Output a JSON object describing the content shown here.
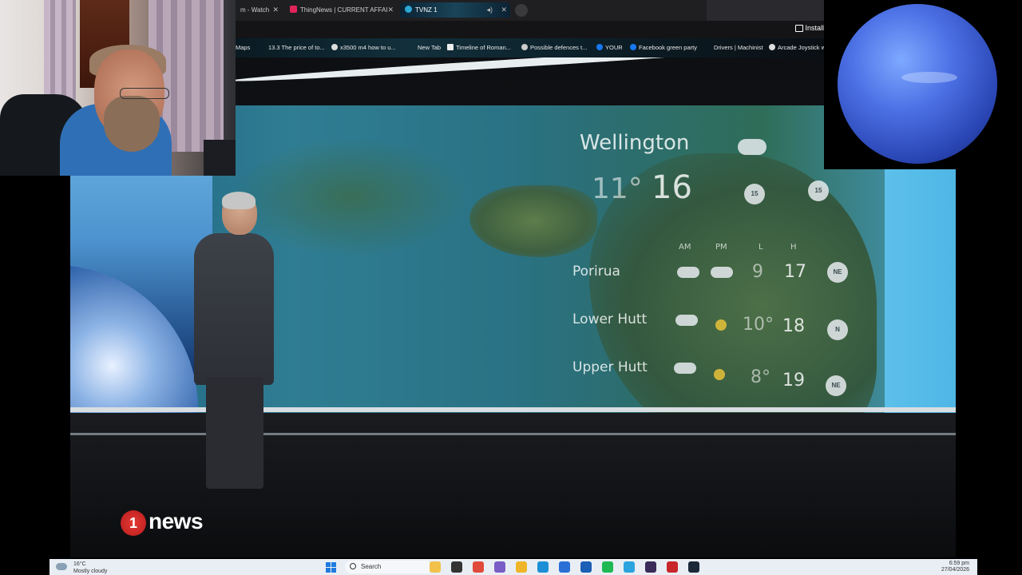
{
  "browser": {
    "tabs": [
      {
        "label": "m - Watch",
        "active": false,
        "icon": "page-icon"
      },
      {
        "label": "ThingNews | CURRENT AFFAI",
        "active": false,
        "icon": "youtube-icon"
      },
      {
        "label": "TVNZ 1",
        "active": true,
        "icon": "tvnz-icon"
      }
    ],
    "install_label": "Install",
    "bookmarks": [
      "Maps",
      "13.3 The price of to...",
      "x3500 m4 how to u...",
      "New Tab",
      "Timeline of Roman...",
      "Possible defences t...",
      "YOUR",
      "Facebook green party",
      "Drivers | Machinist",
      "Arcade Joystick w"
    ]
  },
  "broadcast": {
    "forecast": {
      "city": "Wellington",
      "min": "11°",
      "max": "16",
      "wind_badges": [
        "15",
        "15"
      ],
      "columns": [
        "AM",
        "PM",
        "L",
        "H"
      ],
      "rows": [
        {
          "name": "Porirua",
          "min": "9",
          "max": "17",
          "wind": "NE"
        },
        {
          "name": "Lower Hutt",
          "min": "10°",
          "max": "18",
          "wind": "N"
        },
        {
          "name": "Upper Hutt",
          "min": "8°",
          "max": "19",
          "wind": "NE"
        }
      ]
    },
    "logo_number": "1",
    "logo_word": "news"
  },
  "taskbar": {
    "weather_temp": "16°C",
    "weather_condition": "Mostly cloudy",
    "search_label": "Search",
    "time": "6:59 pm",
    "date": "27/04/2026",
    "apps": [
      {
        "name": "file-explorer-icon",
        "color": "#f2c14b"
      },
      {
        "name": "terminal-icon",
        "color": "#333333"
      },
      {
        "name": "chrome-icon",
        "color": "#e04a3a"
      },
      {
        "name": "store-icon",
        "color": "#7a5cc6"
      },
      {
        "name": "folder-icon",
        "color": "#f0b429"
      },
      {
        "name": "edge-icon",
        "color": "#1d8fd6"
      },
      {
        "name": "mail-icon",
        "color": "#2a6fd6"
      },
      {
        "name": "calendar-icon",
        "color": "#1b5fb6"
      },
      {
        "name": "spotify-icon",
        "color": "#1fb954"
      },
      {
        "name": "telegram-icon",
        "color": "#2aa3de"
      },
      {
        "name": "obs-icon",
        "color": "#3a2b5a"
      },
      {
        "name": "winamp-icon",
        "color": "#c8262b"
      },
      {
        "name": "steam-icon",
        "color": "#1b2838"
      }
    ]
  }
}
